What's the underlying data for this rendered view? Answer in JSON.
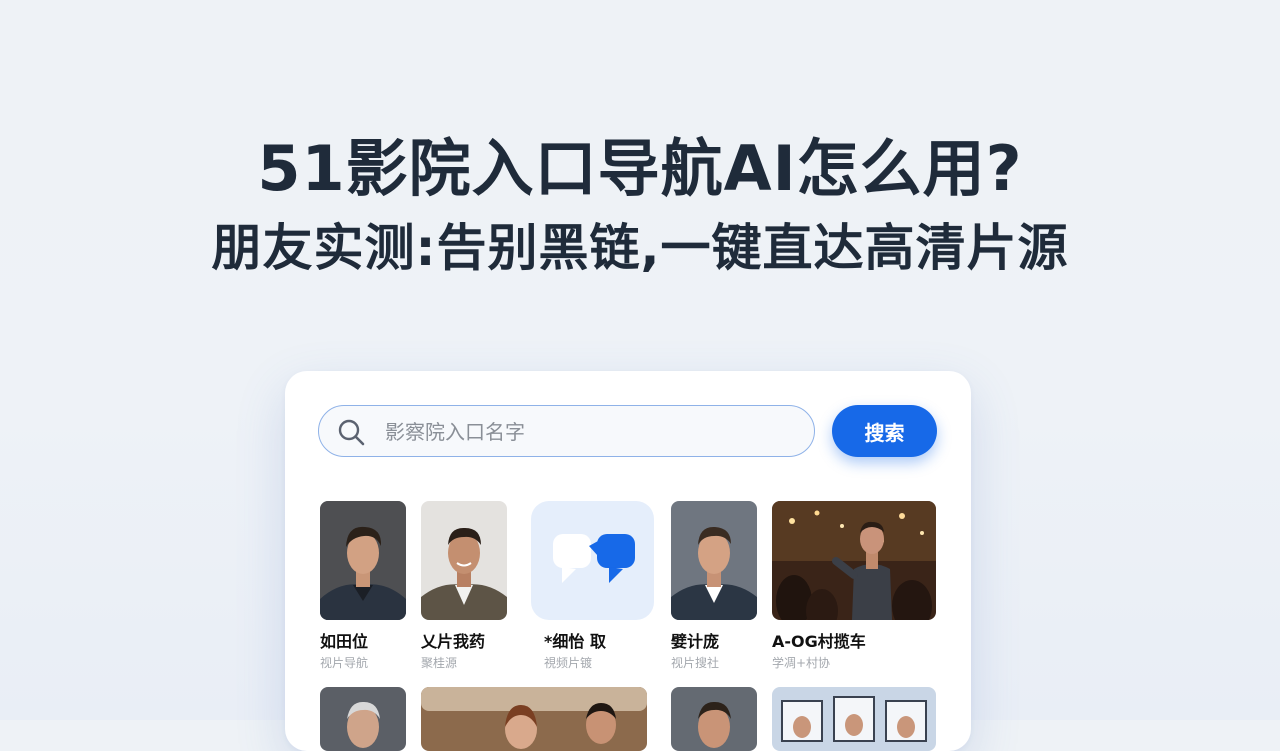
{
  "headline": {
    "line1": "51影院入口导航AI怎么用?",
    "line2": "朋友实测:告别黑链,一键直达高清片源"
  },
  "search": {
    "placeholder": "影察院入口名字",
    "button_label": "搜索",
    "icon": "search-icon"
  },
  "results": [
    {
      "title": "如田位",
      "subtitle": "视片导航",
      "thumb": "portrait-photo"
    },
    {
      "title": "乂片我药",
      "subtitle": "聚桂源",
      "thumb": "portrait-photo"
    },
    {
      "title": "*细怡 取",
      "subtitle": "視频片镀",
      "thumb": "chat-bubbles-icon"
    },
    {
      "title": "嬖计庞",
      "subtitle": "视片搜社",
      "thumb": "portrait-photo"
    },
    {
      "title": "A-OG村揽车",
      "subtitle": "学凋+村协",
      "thumb": "crowd-photo"
    }
  ],
  "colors": {
    "accent": "#1769e8",
    "headline": "#1f2b3a",
    "background": "#eef2f6"
  }
}
